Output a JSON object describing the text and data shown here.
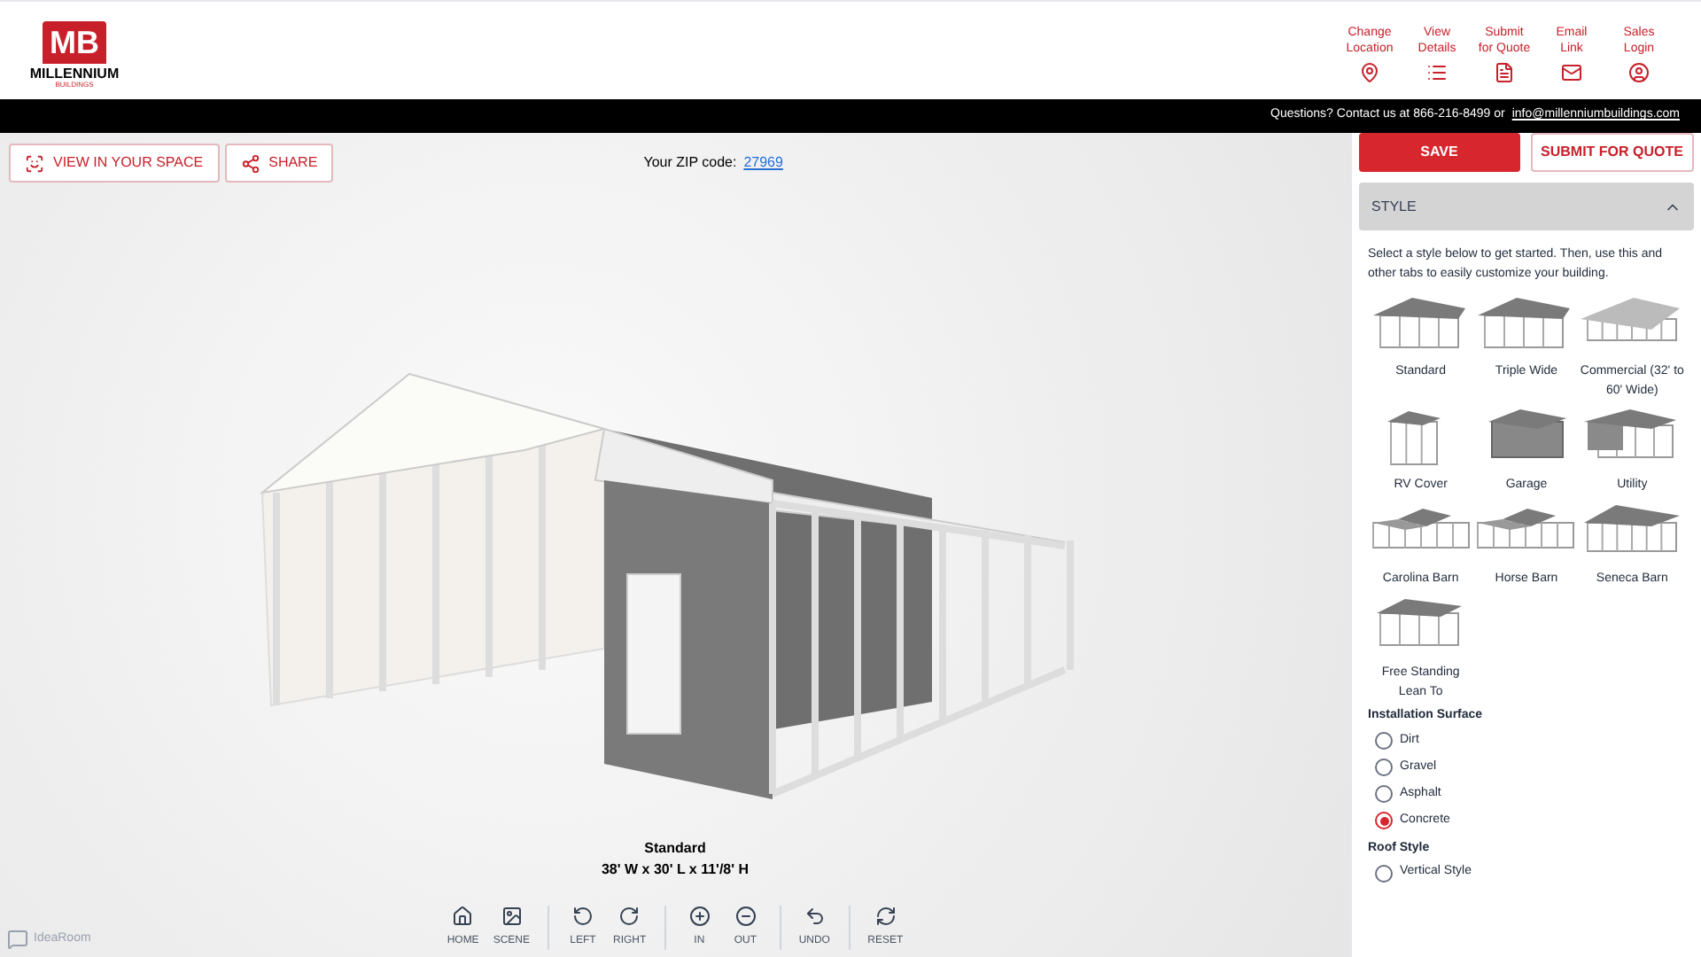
{
  "header": {
    "logo": {
      "letters": "MB",
      "name": "MILLENNIUM",
      "subname": "BUILDINGS"
    },
    "nav": [
      {
        "label": "Change Location",
        "kind": "pin"
      },
      {
        "label": "View Details",
        "kind": "list"
      },
      {
        "label": "Submit for Quote",
        "kind": "doc"
      },
      {
        "label": "Email Link",
        "kind": "mail"
      },
      {
        "label": "Sales Login",
        "kind": "user"
      }
    ]
  },
  "contact_bar": {
    "text": "Questions? Contact us at 866-216-8499 or",
    "email": "info@millenniumbuildings.com"
  },
  "viewer": {
    "buttons": [
      {
        "label": "VIEW IN YOUR SPACE",
        "kind": "ar"
      },
      {
        "label": "SHARE",
        "kind": "share"
      }
    ],
    "zip_label": "Your ZIP code:",
    "zip": "27969",
    "caption": {
      "title": "Standard",
      "size": "38' W x 30' L x 11'/8' H"
    },
    "toolbar": [
      [
        {
          "label": "HOME",
          "kind": "home"
        },
        {
          "label": "SCENE",
          "kind": "image"
        }
      ],
      [
        {
          "label": "LEFT",
          "kind": "rotl"
        },
        {
          "label": "RIGHT",
          "kind": "rotr"
        }
      ],
      [
        {
          "label": "IN",
          "kind": "plus"
        },
        {
          "label": "OUT",
          "kind": "minus"
        }
      ],
      [
        {
          "label": "UNDO",
          "kind": "undo"
        }
      ],
      [
        {
          "label": "RESET",
          "kind": "reset"
        }
      ]
    ],
    "brand": "IdeaRoom"
  },
  "panel": {
    "save": "SAVE",
    "submit": "SUBMIT FOR QUOTE",
    "section": {
      "title": "STYLE",
      "expanded": true
    },
    "intro": "Select a style below to get started. Then, use this and other tabs to easily customize your building.",
    "styles": [
      {
        "label": "Standard",
        "kind": "carport"
      },
      {
        "label": "Triple Wide",
        "kind": "carport"
      },
      {
        "label": "Commercial (32' to 60' Wide)",
        "kind": "wide"
      },
      {
        "label": "RV Cover",
        "kind": "tall"
      },
      {
        "label": "Garage",
        "kind": "garage"
      },
      {
        "label": "Utility",
        "kind": "utility"
      },
      {
        "label": "Carolina Barn",
        "kind": "barn"
      },
      {
        "label": "Horse Barn",
        "kind": "barn"
      },
      {
        "label": "Seneca Barn",
        "kind": "seneca"
      },
      {
        "label": "Free Standing Lean To",
        "kind": "leanto"
      }
    ],
    "surface": {
      "title": "Installation Surface",
      "options": [
        {
          "label": "Dirt",
          "selected": false
        },
        {
          "label": "Gravel",
          "selected": false
        },
        {
          "label": "Asphalt",
          "selected": false
        },
        {
          "label": "Concrete",
          "selected": true
        }
      ]
    },
    "roof": {
      "title": "Roof Style",
      "options": [
        {
          "label": "Vertical Style",
          "selected": false
        }
      ]
    }
  }
}
